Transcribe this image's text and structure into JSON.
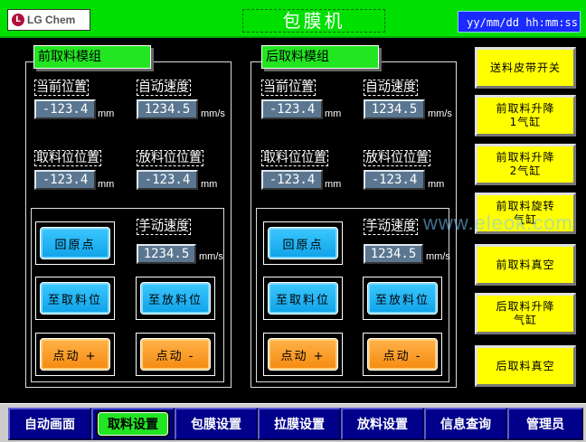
{
  "header": {
    "logo_text": "LG Chem",
    "title": "包膜机",
    "datetime": "yy/mm/dd hh:mm:ss"
  },
  "front_module": {
    "title": "前取料模组",
    "current_pos_label": "当前位置",
    "current_pos_value": "-123.4",
    "current_pos_unit": "mm",
    "auto_speed_label": "自动速度",
    "auto_speed_value": "1234.5",
    "auto_speed_unit": "mm/s",
    "pick_pos_label": "取料位位置",
    "pick_pos_value": "-123.4",
    "pick_pos_unit": "mm",
    "place_pos_label": "放料位位置",
    "place_pos_value": "-123.4",
    "place_pos_unit": "mm",
    "manual_speed_label": "手动速度",
    "manual_speed_value": "1234.5",
    "manual_speed_unit": "mm/s",
    "home_btn": "回原点",
    "to_pick_btn": "至取料位",
    "to_place_btn": "至放料位",
    "jog_plus_btn": "点动 +",
    "jog_minus_btn": "点动 -"
  },
  "rear_module": {
    "title": "后取料模组",
    "current_pos_label": "当前位置",
    "current_pos_value": "-123.4",
    "current_pos_unit": "mm",
    "auto_speed_label": "自动速度",
    "auto_speed_value": "1234.5",
    "auto_speed_unit": "mm/s",
    "pick_pos_label": "取料位位置",
    "pick_pos_value": "-123.4",
    "pick_pos_unit": "mm",
    "place_pos_label": "放料位位置",
    "place_pos_value": "-123.4",
    "place_pos_unit": "mm",
    "manual_speed_label": "手动速度",
    "manual_speed_value": "1234.5",
    "manual_speed_unit": "mm/s",
    "home_btn": "回原点",
    "to_pick_btn": "至取料位",
    "to_place_btn": "至放料位",
    "jog_plus_btn": "点动 +",
    "jog_minus_btn": "点动 -"
  },
  "side_buttons": [
    {
      "line1": "送料皮带开关",
      "line2": ""
    },
    {
      "line1": "前取料升降",
      "line2": "1气缸"
    },
    {
      "line1": "前取料升降",
      "line2": "2气缸"
    },
    {
      "line1": "前取料旋转",
      "line2": "气缸"
    },
    {
      "line1": "前取料真空",
      "line2": ""
    },
    {
      "line1": "后取料升降",
      "line2": "气缸"
    },
    {
      "line1": "后取料真空",
      "line2": ""
    }
  ],
  "tabs": [
    {
      "label": "自动画面"
    },
    {
      "label": "取料设置"
    },
    {
      "label": "包膜设置"
    },
    {
      "label": "拉膜设置"
    },
    {
      "label": "放料设置"
    },
    {
      "label": "信息查询"
    },
    {
      "label": "管理员"
    }
  ],
  "watermark": "www.eleok.com",
  "colors": {
    "header_green": "#00e000",
    "panel_tab_green": "#22e622",
    "button_cyan": "#0ea2e8",
    "button_orange": "#f58a10",
    "button_yellow": "#ffff00",
    "tab_blue": "#00008b",
    "datetime_blue": "#1a2bff"
  }
}
